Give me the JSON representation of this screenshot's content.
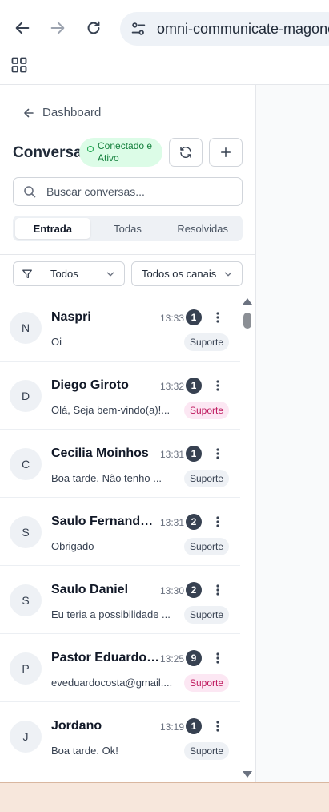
{
  "browser": {
    "url": "omni-communicate-magone",
    "back_icon": "arrow-left-icon",
    "forward_icon": "arrow-right-icon",
    "reload_icon": "reload-icon",
    "site_info_icon": "tune-icon",
    "apps_icon": "apps-grid-icon"
  },
  "sidebar": {
    "back_label": "Dashboard",
    "title": "Conversas",
    "status": "Conectado e Ativo",
    "status_color": "#15803d",
    "refresh_icon": "refresh-icon",
    "add_icon": "plus-icon",
    "search": {
      "placeholder": "Buscar conversas..."
    },
    "tabs": [
      {
        "label": "Entrada",
        "active": true
      },
      {
        "label": "Todas",
        "active": false
      },
      {
        "label": "Resolvidas",
        "active": false
      }
    ],
    "filters": {
      "status": "Todos",
      "channel": "Todos os canais"
    }
  },
  "conversations": [
    {
      "initial": "N",
      "name": "Naspri",
      "time": "13:33",
      "unread": "1",
      "preview": "Oi",
      "tag": "Suporte",
      "tag_style": "gray"
    },
    {
      "initial": "D",
      "name": "Diego Giroto",
      "time": "13:32",
      "unread": "1",
      "preview": "Olá, Seja bem-vindo(a)!...",
      "tag": "Suporte",
      "tag_style": "pink"
    },
    {
      "initial": "C",
      "name": "Cecilia Moinhos",
      "time": "13:31",
      "unread": "1",
      "preview": "Boa tarde. Não tenho ...",
      "tag": "Suporte",
      "tag_style": "gray"
    },
    {
      "initial": "S",
      "name": "Saulo Fernando ...",
      "time": "13:31",
      "unread": "2",
      "preview": "Obrigado",
      "tag": "Suporte",
      "tag_style": "gray"
    },
    {
      "initial": "S",
      "name": "Saulo Daniel",
      "time": "13:30",
      "unread": "2",
      "preview": "Eu teria a possibilidade ...",
      "tag": "Suporte",
      "tag_style": "gray"
    },
    {
      "initial": "P",
      "name": "Pastor Eduardo ...",
      "time": "13:25",
      "unread": "9",
      "preview": "eveduardocosta@gmail....",
      "tag": "Suporte",
      "tag_style": "pink"
    },
    {
      "initial": "J",
      "name": "Jordano",
      "time": "13:19",
      "unread": "1",
      "preview": "Boa tarde. Ok!",
      "tag": "Suporte",
      "tag_style": "gray"
    }
  ]
}
